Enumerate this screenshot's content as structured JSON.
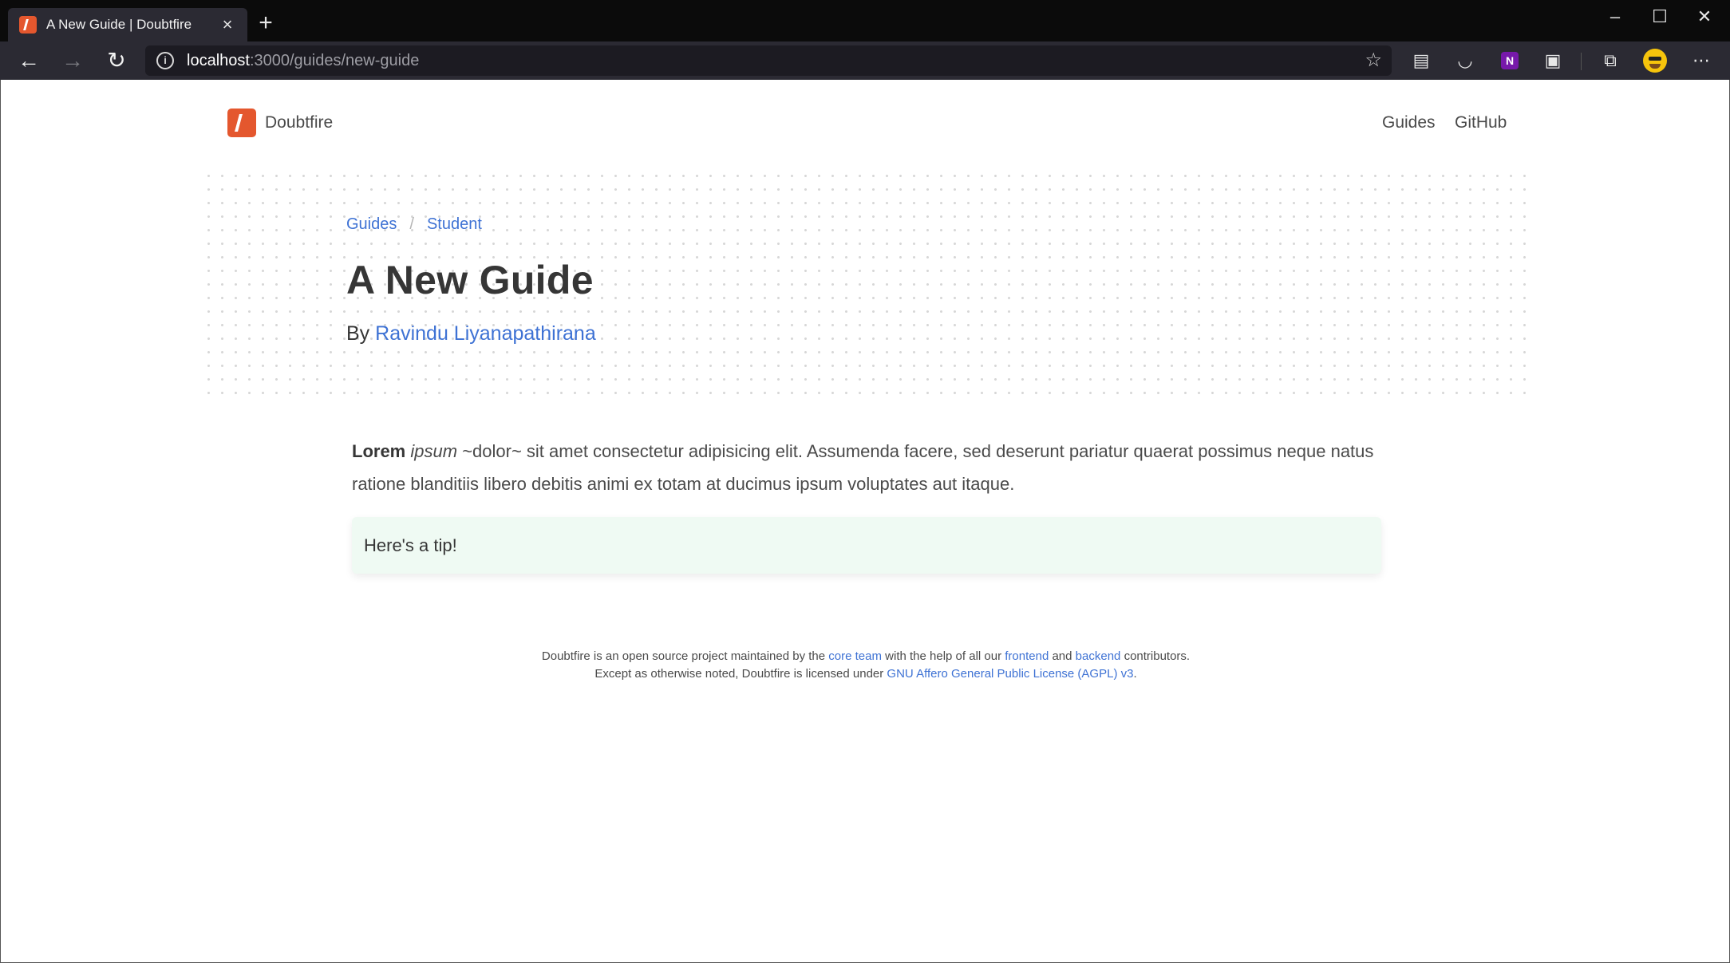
{
  "browser": {
    "tab_title": "A New Guide | Doubtfire",
    "url_host": "localhost",
    "url_path": ":3000/guides/new-guide"
  },
  "site": {
    "name": "Doubtfire",
    "nav": [
      "Guides",
      "GitHub"
    ]
  },
  "hero": {
    "breadcrumbs": [
      "Guides",
      "Student"
    ],
    "breadcrumb_separator": "/",
    "title": "A New Guide",
    "by_label": "By",
    "author": "Ravindu Liyanapathirana"
  },
  "content": {
    "bold": "Lorem",
    "italic": "ipsum",
    "rest": "~dolor~ sit amet consectetur adipisicing elit. Assumenda facere, sed deserunt pariatur quaerat possimus neque natus ratione blanditiis libero debitis animi ex totam at ducimus ipsum voluptates aut itaque.",
    "tip": "Here's a tip!"
  },
  "footer": {
    "line1_a": "Doubtfire is an open source project maintained by the",
    "core_team": "core team",
    "line1_b": "with the help of all our",
    "frontend": "frontend",
    "and": "and",
    "backend": "backend",
    "line1_c": "contributors.",
    "line2_a": "Except as otherwise noted, Doubtfire is licensed under",
    "license": "GNU Affero General Public License (AGPL) v3",
    "line2_b": "."
  },
  "colors": {
    "brand": "#e4572e",
    "link": "#3e72d4",
    "tip_bg": "#effaf3"
  }
}
